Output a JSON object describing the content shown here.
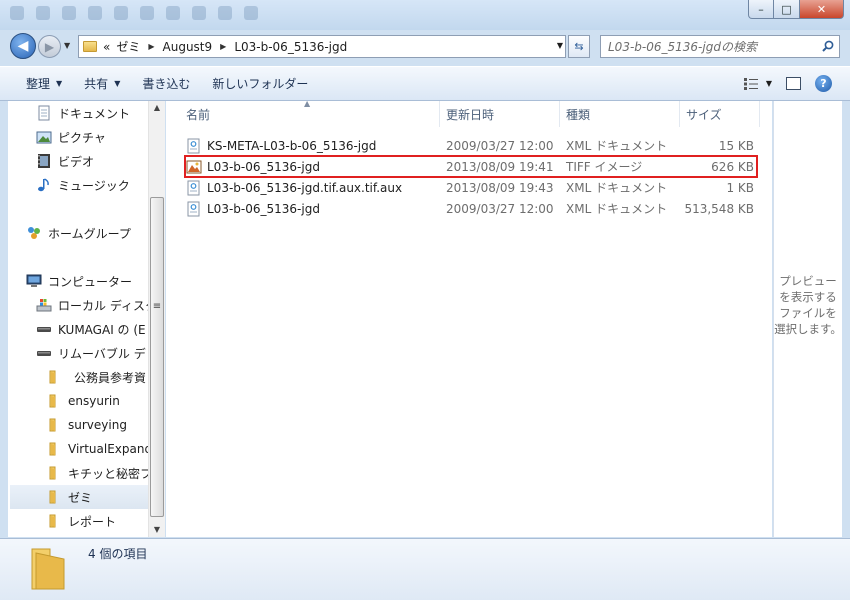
{
  "window": {
    "controls": {
      "minimize": "–",
      "maximize": "□",
      "close": "✕"
    }
  },
  "nav": {
    "back": "◀",
    "forward": "▶"
  },
  "address": {
    "prefix": "«",
    "crumbs": [
      "ゼミ",
      "August9",
      "L03-b-06_5136-jgd"
    ],
    "refresh": "⇆"
  },
  "search": {
    "placeholder": "L03-b-06_5136-jgdの検索"
  },
  "toolbar": {
    "organize": "整理",
    "share": "共有",
    "burn": "書き込む",
    "new_folder": "新しいフォルダー",
    "help": "?"
  },
  "sidebar": {
    "items": [
      {
        "label": "ドキュメント",
        "icon": "document-icon"
      },
      {
        "label": "ピクチャ",
        "icon": "pictures-icon"
      },
      {
        "label": "ビデオ",
        "icon": "video-icon"
      },
      {
        "label": "ミュージック",
        "icon": "music-icon"
      },
      {
        "label": "ホームグループ",
        "icon": "homegroup-icon"
      },
      {
        "label": "コンピューター",
        "icon": "computer-icon"
      },
      {
        "label": "ローカル ディスク",
        "icon": "local-disk-icon"
      },
      {
        "label": "KUMAGAI の (E",
        "icon": "drive-icon"
      },
      {
        "label": "リムーバブル デ",
        "icon": "drive-icon"
      },
      {
        "label": "公務員参考資",
        "icon": "folder-icon"
      },
      {
        "label": "ensyurin",
        "icon": "folder-icon"
      },
      {
        "label": "surveying",
        "icon": "folder-icon"
      },
      {
        "label": "VirtualExpand",
        "icon": "folder-icon"
      },
      {
        "label": "キチッと秘密フ",
        "icon": "folder-icon"
      },
      {
        "label": "ゼミ",
        "icon": "folder-icon"
      },
      {
        "label": "レポート",
        "icon": "folder-icon"
      }
    ]
  },
  "columns": {
    "name": "名前",
    "date": "更新日時",
    "type": "種類",
    "size": "サイズ"
  },
  "files": [
    {
      "name": "KS-META-L03-b-06_5136-jgd",
      "date": "2009/03/27 12:00",
      "type": "XML ドキュメント",
      "size": "15 KB",
      "icon": "xml-file-icon"
    },
    {
      "name": "L03-b-06_5136-jgd",
      "date": "2013/08/09 19:41",
      "type": "TIFF イメージ",
      "size": "626 KB",
      "icon": "tiff-file-icon"
    },
    {
      "name": "L03-b-06_5136-jgd.tif.aux.tif.aux",
      "date": "2013/08/09 19:43",
      "type": "XML ドキュメント",
      "size": "1 KB",
      "icon": "xml-file-icon"
    },
    {
      "name": "L03-b-06_5136-jgd",
      "date": "2009/03/27 12:00",
      "type": "XML ドキュメント",
      "size": "513,548 KB",
      "icon": "xml-file-icon"
    }
  ],
  "preview": {
    "message": "プレビューを表示するファイルを選択します。"
  },
  "status": {
    "count": "4 個の項目"
  }
}
